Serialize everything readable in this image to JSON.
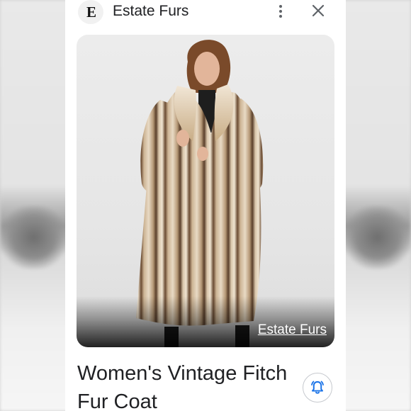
{
  "header": {
    "site_logo_letter": "E",
    "site_name": "Estate Furs"
  },
  "image_card": {
    "source_label": "Estate Furs"
  },
  "product": {
    "title": "Women's Vintage Fitch Fur Coat"
  },
  "icons": {
    "menu": "more-vert-icon",
    "close": "close-icon",
    "alert": "bell-alert-icon"
  },
  "colors": {
    "accent": "#1a73e8",
    "text": "#202124"
  }
}
